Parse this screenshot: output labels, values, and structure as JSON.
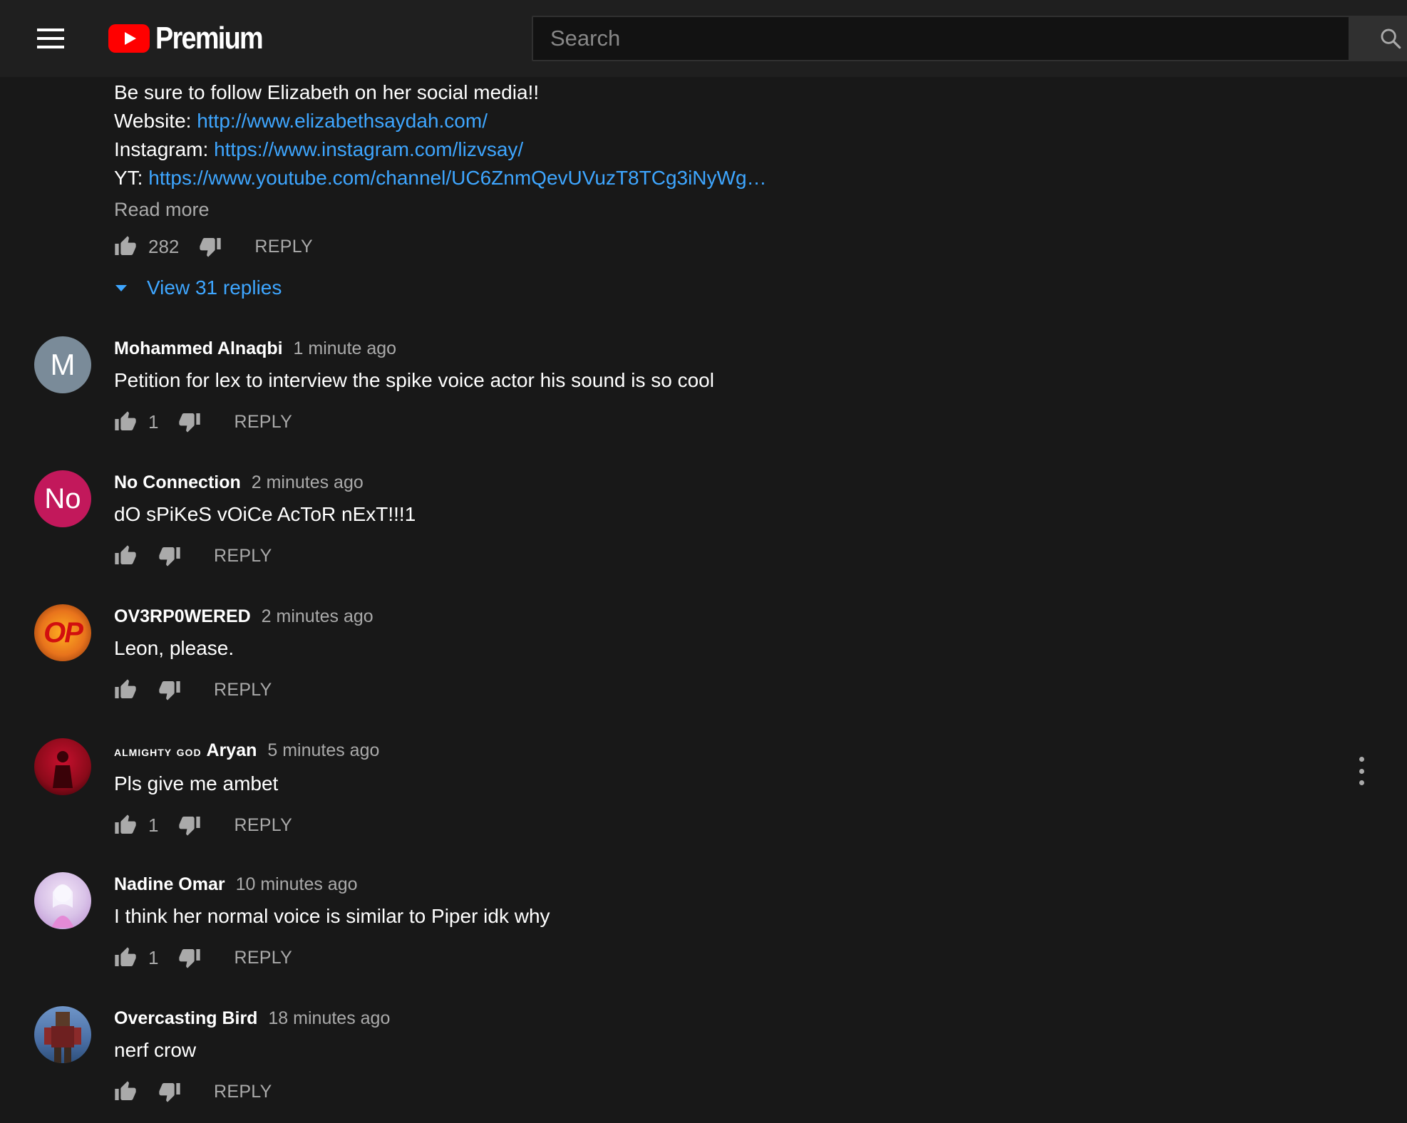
{
  "header": {
    "logo_text": "Premium",
    "search_placeholder": "Search",
    "brand_color": "#ff0000"
  },
  "pinned_comment": {
    "line1": "Be sure to follow Elizabeth on her social media!!",
    "website_label": "Website:",
    "website_url": "http://www.elizabethsaydah.com/",
    "instagram_label": "Instagram:",
    "instagram_url": "https://www.instagram.com/lizvsay/",
    "yt_label": "YT:",
    "yt_url": "https://www.youtube.com/channel/UC6ZnmQevUVuzT8TCg3iNyWg…",
    "read_more": "Read more",
    "likes": "282",
    "reply_label": "REPLY",
    "view_replies": "View 31 replies"
  },
  "comments": [
    {
      "avatar_letter": "M",
      "avatar_color": "#7a8b99",
      "author": "Mohammed Alnaqbi",
      "time": "1 minute ago",
      "text": "Petition for lex to interview the spike voice actor his sound is so cool",
      "likes": "1",
      "reply_label": "REPLY"
    },
    {
      "avatar_letter": "No",
      "avatar_color": "#c2185b",
      "author": "No Connection",
      "time": "2 minutes ago",
      "text": "dO sPiKeS vOiCe AcToR nExT!!!1",
      "likes": "",
      "reply_label": "REPLY"
    },
    {
      "avatar_letter": "OP",
      "avatar_color": "#e8731c",
      "author": "OV3RP0WERED",
      "time": "2 minutes ago",
      "text": "Leon, please.",
      "likes": "",
      "reply_label": "REPLY"
    },
    {
      "avatar_letter": "",
      "avatar_color": "#8b0a1a",
      "author_prefix": "almighty god",
      "author": "Aryan",
      "time": "5 minutes ago",
      "text": "Pls give me ambet",
      "likes": "1",
      "reply_label": "REPLY"
    },
    {
      "avatar_letter": "",
      "avatar_color": "#d9c3e8",
      "author": "Nadine Omar",
      "time": "10 minutes ago",
      "text": "I think her normal voice is similar to Piper idk why",
      "likes": "1",
      "reply_label": "REPLY"
    },
    {
      "avatar_letter": "",
      "avatar_color": "#4a6fa5",
      "author": "Overcasting Bird",
      "time": "18 minutes ago",
      "text": "nerf crow",
      "likes": "",
      "reply_label": "REPLY"
    }
  ]
}
